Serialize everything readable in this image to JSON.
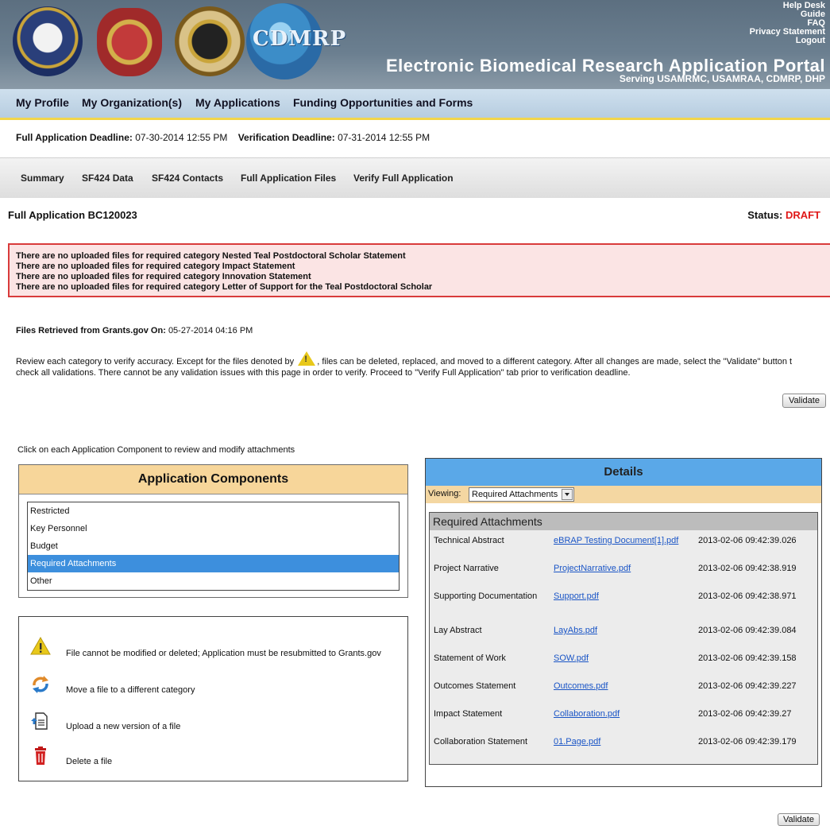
{
  "header": {
    "seals": [
      "dod-seal",
      "protect-sustain-seal",
      "usamraa-seal",
      "cdmrp-logo"
    ],
    "cdmrp_label": "CDMRP",
    "links": [
      "Help Desk",
      "Guide",
      "FAQ",
      "Privacy Statement",
      "Logout"
    ],
    "portal_title": "Electronic Biomedical Research Application Portal",
    "serving": "Serving  USAMRMC,  USAMRAA,  CDMRP,  DHP"
  },
  "main_nav": [
    "My Profile",
    "My Organization(s)",
    "My Applications",
    "Funding Opportunities and Forms"
  ],
  "deadlines": {
    "full_label": "Full Application Deadline:",
    "full_value": "07-30-2014 12:55 PM",
    "verify_label": "Verification Deadline:",
    "verify_value": "07-31-2014 12:55 PM"
  },
  "sub_nav": [
    "Summary",
    "SF424 Data",
    "SF424 Contacts",
    "Full Application Files",
    "Verify Full Application"
  ],
  "application": {
    "title": "Full Application BC120023",
    "status_label": "Status:",
    "status_value": "DRAFT"
  },
  "errors": [
    "There are no uploaded files for required category Nested Teal Postdoctoral Scholar Statement",
    "There are no uploaded files for required category Impact Statement",
    "There are no uploaded files for required category Innovation Statement",
    "There are no uploaded files for required category Letter of Support for the Teal Postdoctoral Scholar"
  ],
  "retrieved": {
    "label": "Files Retrieved from Grants.gov On:",
    "value": "05-27-2014 04:16 PM"
  },
  "instructions": {
    "line1_before_icon": "Review each category to verify accuracy. Except for the files denoted by",
    "line1_after_icon": ", files can be deleted, replaced, and moved to a different category. After all changes are made, select the \"Validate\" button t",
    "line2": "check all validations. There cannot be any validation issues with this page in order to verify. Proceed to \"Verify Full Application\" tab prior to verification deadline."
  },
  "validate_label": "Validate",
  "click_hint": "Click on each Application Component to review and modify attachments",
  "components": {
    "title": "Application Components",
    "items": [
      "Restricted",
      "Key Personnel",
      "Budget",
      "Required Attachments",
      "Other"
    ],
    "selected_index": 3
  },
  "legend": [
    {
      "icon": "warning-icon",
      "text": "File cannot be modified or deleted; Application must be resubmitted to Grants.gov"
    },
    {
      "icon": "move-icon",
      "text": "Move a file to a different category"
    },
    {
      "icon": "upload-icon",
      "text": "Upload a new version of a file"
    },
    {
      "icon": "trash-icon",
      "text": "Delete a file"
    }
  ],
  "details": {
    "title": "Details",
    "viewing_label": "Viewing:",
    "viewing_value": "Required Attachments",
    "section_title": "Required Attachments",
    "rows": [
      {
        "name": "Technical Abstract",
        "file": "eBRAP Testing Document[1].pdf",
        "date": "2013-02-06 09:42:39.026"
      },
      {
        "name": "Project Narrative",
        "file": "ProjectNarrative.pdf",
        "date": "2013-02-06 09:42:38.919"
      },
      {
        "name": "Supporting Documentation",
        "file": "Support.pdf",
        "date": "2013-02-06 09:42:38.971"
      },
      {
        "name": "Lay Abstract",
        "file": "LayAbs.pdf",
        "date": "2013-02-06 09:42:39.084"
      },
      {
        "name": "Statement of Work",
        "file": "SOW.pdf",
        "date": "2013-02-06 09:42:39.158"
      },
      {
        "name": "Outcomes Statement",
        "file": "Outcomes.pdf",
        "date": "2013-02-06 09:42:39.227"
      },
      {
        "name": "Impact Statement",
        "file": "Collaboration.pdf",
        "date": "2013-02-06 09:42:39.27"
      },
      {
        "name": "Collaboration Statement",
        "file": "01.Page.pdf",
        "date": "2013-02-06 09:42:39.179"
      }
    ]
  },
  "colors": {
    "status_draft": "#e01818",
    "selected_row": "#3d8fdd",
    "components_header": "#f7d69a",
    "details_header": "#5aa8e8",
    "link": "#1a55c6"
  }
}
